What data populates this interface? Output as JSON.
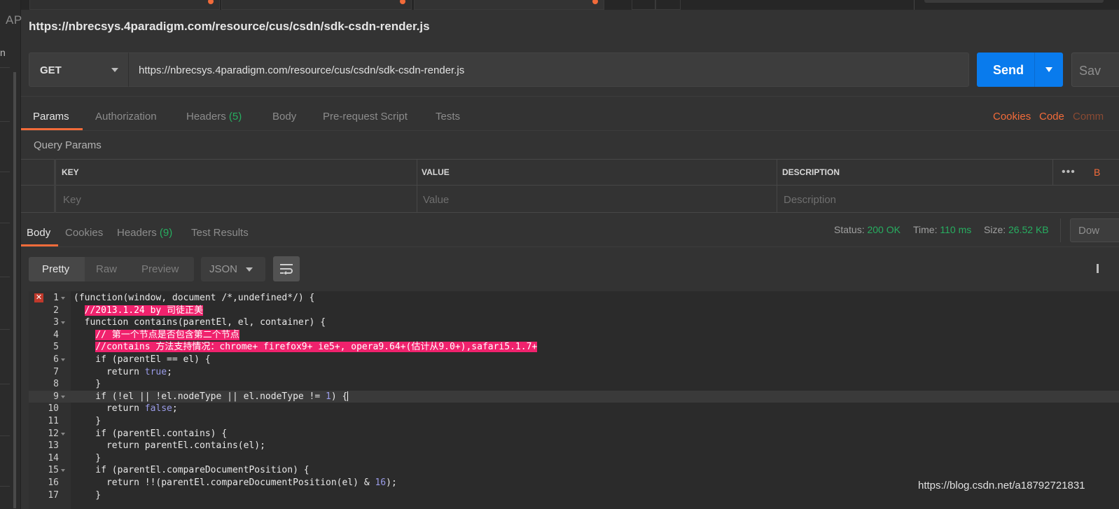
{
  "sidebar": {
    "label": "AP",
    "n": "n"
  },
  "request": {
    "title": "https://nbrecsys.4paradigm.com/resource/cus/csdn/sdk-csdn-render.js",
    "method": "GET",
    "url": "https://nbrecsys.4paradigm.com/resource/cus/csdn/sdk-csdn-render.js",
    "send_label": "Send",
    "save_label": "Sav"
  },
  "request_tabs": {
    "params": "Params",
    "authorization": "Authorization",
    "headers": "Headers",
    "headers_count": "(5)",
    "body": "Body",
    "prerequest": "Pre-request Script",
    "tests": "Tests",
    "cookies": "Cookies",
    "code": "Code",
    "comments": "Comm"
  },
  "query_params": {
    "title": "Query Params",
    "columns": [
      "KEY",
      "VALUE",
      "DESCRIPTION"
    ],
    "placeholders": [
      "Key",
      "Value",
      "Description"
    ],
    "bulk_edit": "B"
  },
  "response": {
    "tabs": {
      "body": "Body",
      "cookies": "Cookies",
      "headers": "Headers",
      "headers_count": "(9)",
      "test_results": "Test Results"
    },
    "status_label": "Status:",
    "status_value": "200 OK",
    "time_label": "Time:",
    "time_value": "110 ms",
    "size_label": "Size:",
    "size_value": "26.52 KB",
    "download_label": "Dow",
    "formats": [
      "Pretty",
      "Raw",
      "Preview"
    ],
    "language": "JSON"
  },
  "code_lines": [
    {
      "n": "1",
      "fold": true,
      "html": "(function(window, document /*,undefined*/) {"
    },
    {
      "n": "2",
      "fold": false,
      "html": "  <span class=\"hl\">//2013.1.24 by 司徒正美</span>"
    },
    {
      "n": "3",
      "fold": true,
      "html": "  function contains(parentEl, el, container) {"
    },
    {
      "n": "4",
      "fold": false,
      "html": "    <span class=\"hl\">// 第一个节点是否包含第二个节点</span>"
    },
    {
      "n": "5",
      "fold": false,
      "html": "    <span class=\"hl\">//contains 方法支持情况：chrome+ firefox9+ ie5+, opera9.64+(估计从9.0+),safari5.1.7+</span>"
    },
    {
      "n": "6",
      "fold": true,
      "html": "    if (parentEl == el) {"
    },
    {
      "n": "7",
      "fold": false,
      "html": "      return <span class=\"kw\">true</span>;"
    },
    {
      "n": "8",
      "fold": false,
      "html": "    }"
    },
    {
      "n": "9",
      "fold": true,
      "cur": true,
      "html": "    if (!el || !el.nodeType || el.nodeType != <span class=\"kw\">1</span>) {<span class=\"cursor\"></span>"
    },
    {
      "n": "10",
      "fold": false,
      "html": "      return <span class=\"kw\">false</span>;"
    },
    {
      "n": "11",
      "fold": false,
      "html": "    }"
    },
    {
      "n": "12",
      "fold": true,
      "html": "    if (parentEl.contains) {"
    },
    {
      "n": "13",
      "fold": false,
      "html": "      return parentEl.contains(el);"
    },
    {
      "n": "14",
      "fold": false,
      "html": "    }"
    },
    {
      "n": "15",
      "fold": true,
      "html": "    if (parentEl.compareDocumentPosition) {"
    },
    {
      "n": "16",
      "fold": false,
      "html": "      return !!(parentEl.compareDocumentPosition(el) &amp; <span class=\"kw\">16</span>);"
    },
    {
      "n": "17",
      "fold": false,
      "html": "    }"
    }
  ],
  "watermark": "https://blog.csdn.net/a18792721831",
  "colors": {
    "accent": "#f26b3a",
    "send": "#097bed",
    "ok": "#27ae60",
    "highlight": "#f0226d"
  }
}
